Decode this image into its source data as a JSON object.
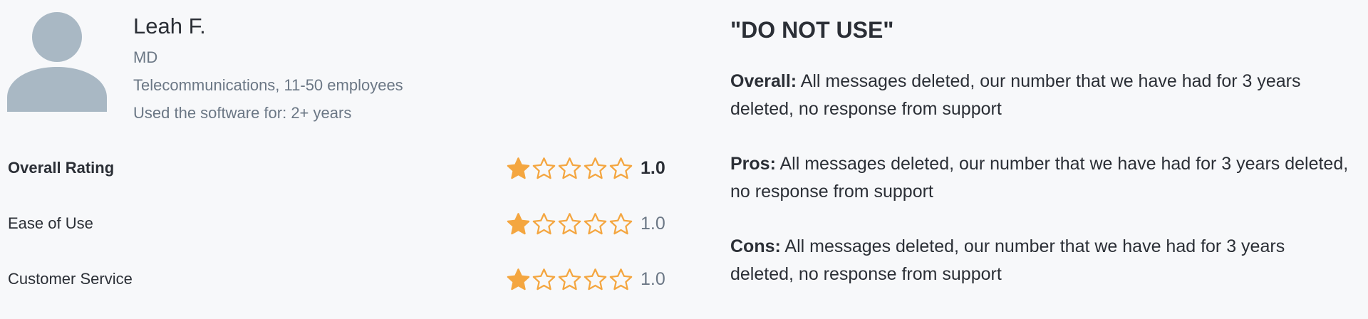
{
  "reviewer": {
    "name": "Leah F.",
    "role": "MD",
    "company": "Telecommunications, 11-50 employees",
    "usage": "Used the software for: 2+ years",
    "avatar_icon": "user-silhouette-icon"
  },
  "ratings": [
    {
      "label": "Overall Rating",
      "value": "1.0",
      "stars": 1,
      "max_stars": 5
    },
    {
      "label": "Ease of Use",
      "value": "1.0",
      "stars": 1,
      "max_stars": 5
    },
    {
      "label": "Customer Service",
      "value": "1.0",
      "stars": 1,
      "max_stars": 5
    }
  ],
  "review": {
    "title": "\"DO NOT USE\"",
    "overall_label": "Overall:",
    "overall_text": "All messages deleted, our number that we have had for 3 years deleted, no response from support",
    "pros_label": "Pros:",
    "pros_text": "All messages deleted, our number that we have had for 3 years deleted, no response from support",
    "cons_label": "Cons:",
    "cons_text": "All messages deleted, our number that we have had for 3 years deleted, no response from support"
  },
  "colors": {
    "background": "#f7f8fa",
    "avatar": "#a9b8c4",
    "star": "#f4a640",
    "text": "#2b2f36",
    "muted_text": "#6b7785"
  }
}
